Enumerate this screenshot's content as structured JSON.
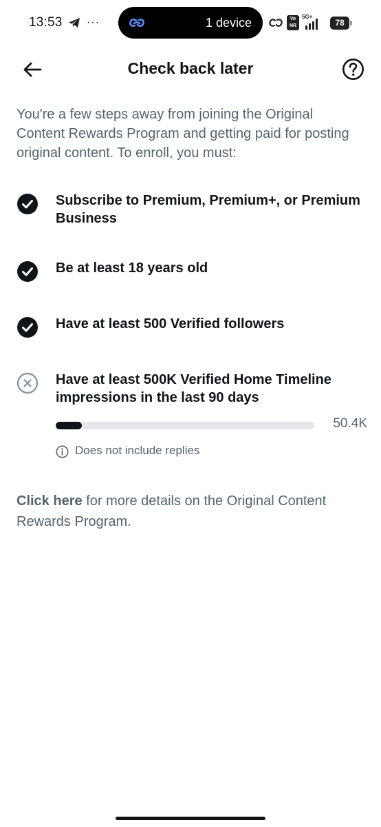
{
  "status_bar": {
    "time": "13:53",
    "more_indicator": "···",
    "island_text": "1 device",
    "network_label": "5G+",
    "vonr_line1": "Vo",
    "vonr_line2": "NR",
    "battery_level": "78"
  },
  "header": {
    "title": "Check back later",
    "back_icon": "arrow-left-icon",
    "help_icon": "question-circle-icon"
  },
  "intro": {
    "text": "You're a few steps away from joining the Original Content Rewards Program and getting paid for posting original content. To enroll, you must:"
  },
  "requirements": [
    {
      "text": "Subscribe to Premium, Premium+, or Premium Business",
      "status": "met",
      "icon": "check-circle-icon"
    },
    {
      "text": "Be at least 18 years old",
      "status": "met",
      "icon": "check-circle-icon"
    },
    {
      "text": "Have at least 500 Verified followers",
      "status": "met",
      "icon": "check-circle-icon"
    },
    {
      "text": "Have at least 500K Verified Home Timeline impressions in the last 90 days",
      "status": "unmet",
      "icon": "x-circle-icon"
    }
  ],
  "impressions_progress": {
    "current_label": "50.4K",
    "current": 50400,
    "target": 500000,
    "fraction": 0.1,
    "note": "Does not include replies",
    "note_icon": "info-icon"
  },
  "footer": {
    "link_text": "Click here",
    "rest_text": " for more details on the Original Content Rewards Program."
  },
  "colors": {
    "primary_text": "#0f1419",
    "secondary_text": "#536471",
    "track": "#e5e7e9",
    "unmet_icon": "#8b98a5"
  }
}
